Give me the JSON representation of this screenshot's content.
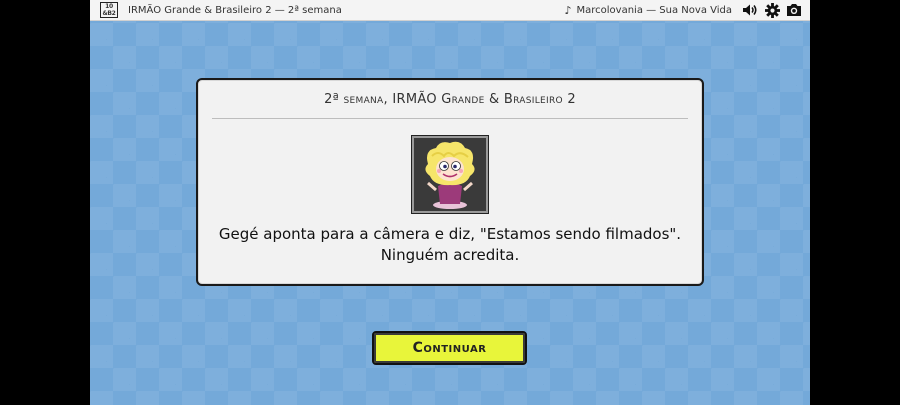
{
  "topbar": {
    "logo_line1": "10",
    "logo_line2": "&B2",
    "game_title": "IRMÃO Grande & Brasileiro 2 — 2ª semana",
    "music_icon": "music-note-icon",
    "music_track": "Marcolovania — Sua Nova Vida",
    "icons": [
      "volume-icon",
      "gear-icon",
      "camera-icon"
    ]
  },
  "dialog": {
    "title": "2ª semana, IRMÃO Grande & Brasileiro 2",
    "portrait": "character-portrait",
    "text_line1": "Gegé aponta para a câmera e diz, \"Estamos sendo filmados\".",
    "text_line2": "Ninguém acredita."
  },
  "continue_button": {
    "label": "Continuar"
  },
  "colors": {
    "background": "#74a9d9",
    "button": "#e8f53a",
    "dialog": "#f2f2f2"
  }
}
